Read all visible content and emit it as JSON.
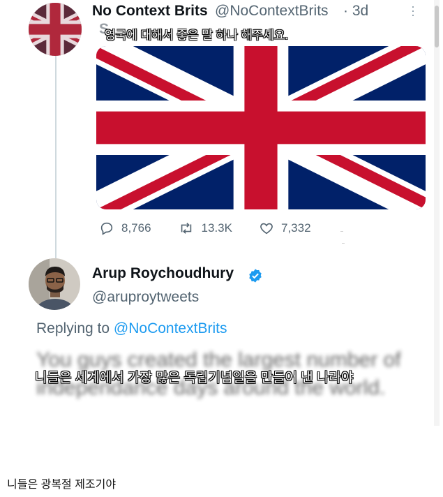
{
  "tweet1": {
    "name": "No Context Brits",
    "handle": "@NoContextBrits",
    "time": "· 3d",
    "hidden_text_start": "S",
    "overlay_ko": "영국에 대해서 좋은 말 하나 해주세요.",
    "stats": {
      "replies": "8,766",
      "retweets": "13.3K",
      "likes": "7,332"
    }
  },
  "tweet2": {
    "name": "Arup Roychoudhury",
    "handle": "@aruproytweets",
    "replying_prefix": "Replying to ",
    "replying_handle": "@NoContextBrits",
    "body": "You guys created the largest number of independance days around the world.",
    "overlay_ko": "니들은 세계에서 가장 많은 독립기념일을 만들어 낸 나라야"
  },
  "caption": "니들은 광복절 제조기야",
  "colors": {
    "flag_blue": "#012169",
    "flag_red": "#C8102E",
    "link": "#1d9bf0",
    "verified": "#1d9bf0"
  },
  "icons": [
    "reply-icon",
    "retweet-icon",
    "like-icon",
    "verified-badge-icon",
    "more-icon"
  ]
}
